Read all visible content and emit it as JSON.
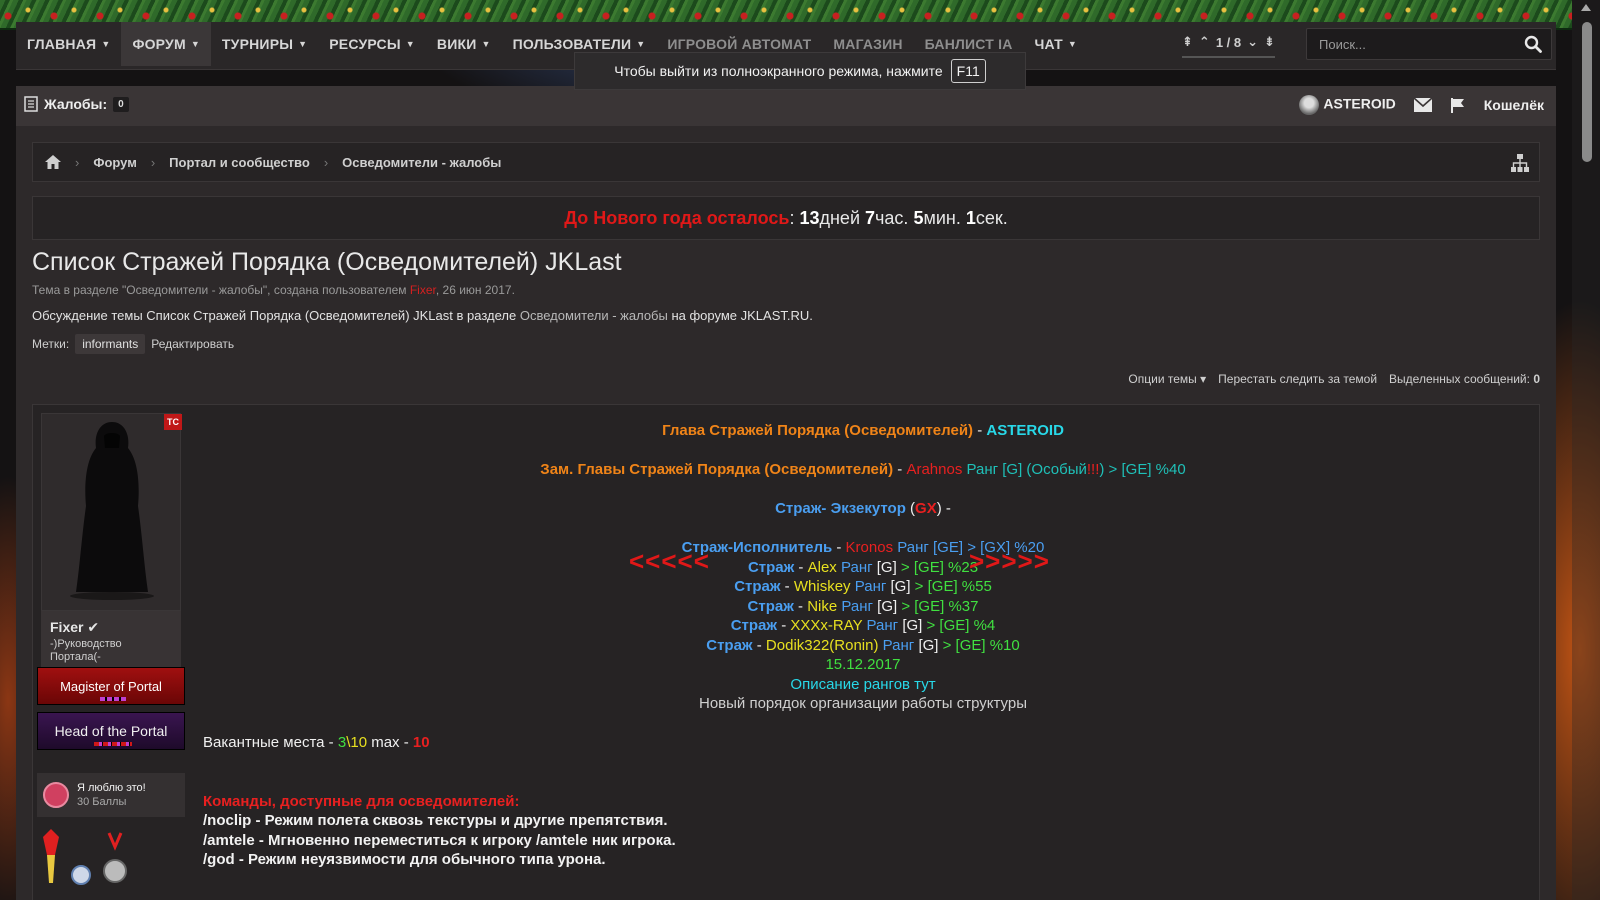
{
  "nav": {
    "items": [
      {
        "label": "ГЛАВНАЯ",
        "caret": true
      },
      {
        "label": "ФОРУМ",
        "caret": true
      },
      {
        "label": "ТУРНИРЫ",
        "caret": true
      },
      {
        "label": "РЕСУРСЫ",
        "caret": true
      },
      {
        "label": "ВИКИ",
        "caret": true
      },
      {
        "label": "ПОЛЬЗОВАТЕЛИ",
        "caret": true
      },
      {
        "label": "ИГРОВОЙ АВТОМАТ",
        "caret": false
      },
      {
        "label": "МАГАЗИН",
        "caret": false
      },
      {
        "label": "БАНЛИСТ IA",
        "caret": false
      },
      {
        "label": "ЧАТ",
        "caret": true
      }
    ],
    "pager_text": "1 / 8",
    "search_placeholder": "Поиск..."
  },
  "fullscreen_notice": {
    "text": "Чтобы выйти из полноэкранного режима, нажмите",
    "key": "F11"
  },
  "userbar": {
    "complaints_label": "Жалобы:",
    "complaints_count": "0",
    "username": "ASTEROID",
    "wallet": "Кошелёк"
  },
  "breadcrumb": {
    "items": [
      "Форум",
      "Портал и сообщество",
      "Осведомители - жалобы"
    ]
  },
  "countdown": {
    "label": "До Нового года осталось",
    "days": "13",
    "days_unit": "дней",
    "hours": "7",
    "hours_unit": "час.",
    "minutes": "5",
    "minutes_unit": "мин.",
    "seconds": "1",
    "seconds_unit": "сек."
  },
  "thread": {
    "title": "Список Стражей Порядка (Осведомителей) JKLast",
    "meta_prefix": "Тема в разделе \"Осведомители - жалобы\", создана пользователем",
    "meta_author": "Fixer",
    "meta_date": ", 26 июн 2017.",
    "discuss_prefix": "Обсуждение темы Список Стражей Порядка (Осведомителей) JKLast в разделе",
    "discuss_link": "Осведомители - жалобы",
    "discuss_suffix": "на форуме JKLAST.RU.",
    "tags_label": "Метки:",
    "tag": "informants",
    "tags_edit": "Редактировать",
    "options": "Опции темы",
    "unwatch": "Перестать следить за темой",
    "selected_label": "Выделенных сообщений:",
    "selected_count": "0"
  },
  "author": {
    "tc_badge": "ТС",
    "name": "Fixer",
    "title": "-)Руководство Портала(-",
    "banner1": "Magister of Portal",
    "banner2": "Head of the Portal",
    "trophy_title": "Я люблю это!",
    "trophy_points": "30 Баллы"
  },
  "post": {
    "head_label": "Глава Стражей Порядка (Осведомителей)",
    "head_dash": " - ",
    "head_name": "ASTEROID",
    "deputy_label": "Зам. Главы Стражей Порядка (Осведомителей)",
    "deputy_dash": " - ",
    "deputy_name": "Arahnos",
    "deputy_rank": " Ранг [G] (Особый",
    "deputy_excl": "!!!",
    "deputy_rest": ") > [GE] %40",
    "exec_label": "Страж- Экзекутор",
    "exec_open": " (",
    "exec_gx": "GX",
    "exec_close": ") -",
    "enforcer_label": "Страж-Исполнитель",
    "enforcer_dash": " - ",
    "enforcer_name": "Kronos",
    "enforcer_rank": " Ранг [GE] > [GX] %20",
    "arrows_left": "<<<<<",
    "arrows_right": ">>>>>",
    "guards": [
      {
        "label": "Страж",
        "name": "Alex",
        "rank_word": " Ранг ",
        "g": "[G]",
        "rest": " > [GE] %23"
      },
      {
        "label": "Страж",
        "name": "Whiskey",
        "rank_word": " Ранг ",
        "g": "[G]",
        "rest": " > [GE] %55"
      },
      {
        "label": "Страж",
        "name": "Nike",
        "rank_word": " Ранг ",
        "g": "[G]",
        "rest": " > [GE] %37"
      },
      {
        "label": "Страж",
        "name": "XXXx-RAY",
        "rank_word": " Ранг ",
        "g": "[G]",
        "rest": " > [GE] %4"
      },
      {
        "label": "Страж",
        "name": "Dodik322(Ronin)",
        "rank_word": " Ранг ",
        "g": "[G]",
        "rest": " > [GE] %10"
      }
    ],
    "date": "15.12.2017",
    "ranks_link": "Описание рангов тут",
    "order_text": "Новый порядок организации работы структуры",
    "vacancy_prefix": "Вакантные места - ",
    "vacancy_current": "3",
    "vacancy_sep": "\\",
    "vacancy_total": "10",
    "vacancy_max_label": " max - ",
    "vacancy_max": "10",
    "commands_title": "Команды, доступные для осведомителей:",
    "commands": [
      "/noclip - Режим полета сквозь текстуры и другие препятствия.",
      "/amtele - Мгновенно переместиться к игроку /amtele ник игрока.",
      "/god - Режим неуязвимости для обычного типа урона."
    ]
  }
}
